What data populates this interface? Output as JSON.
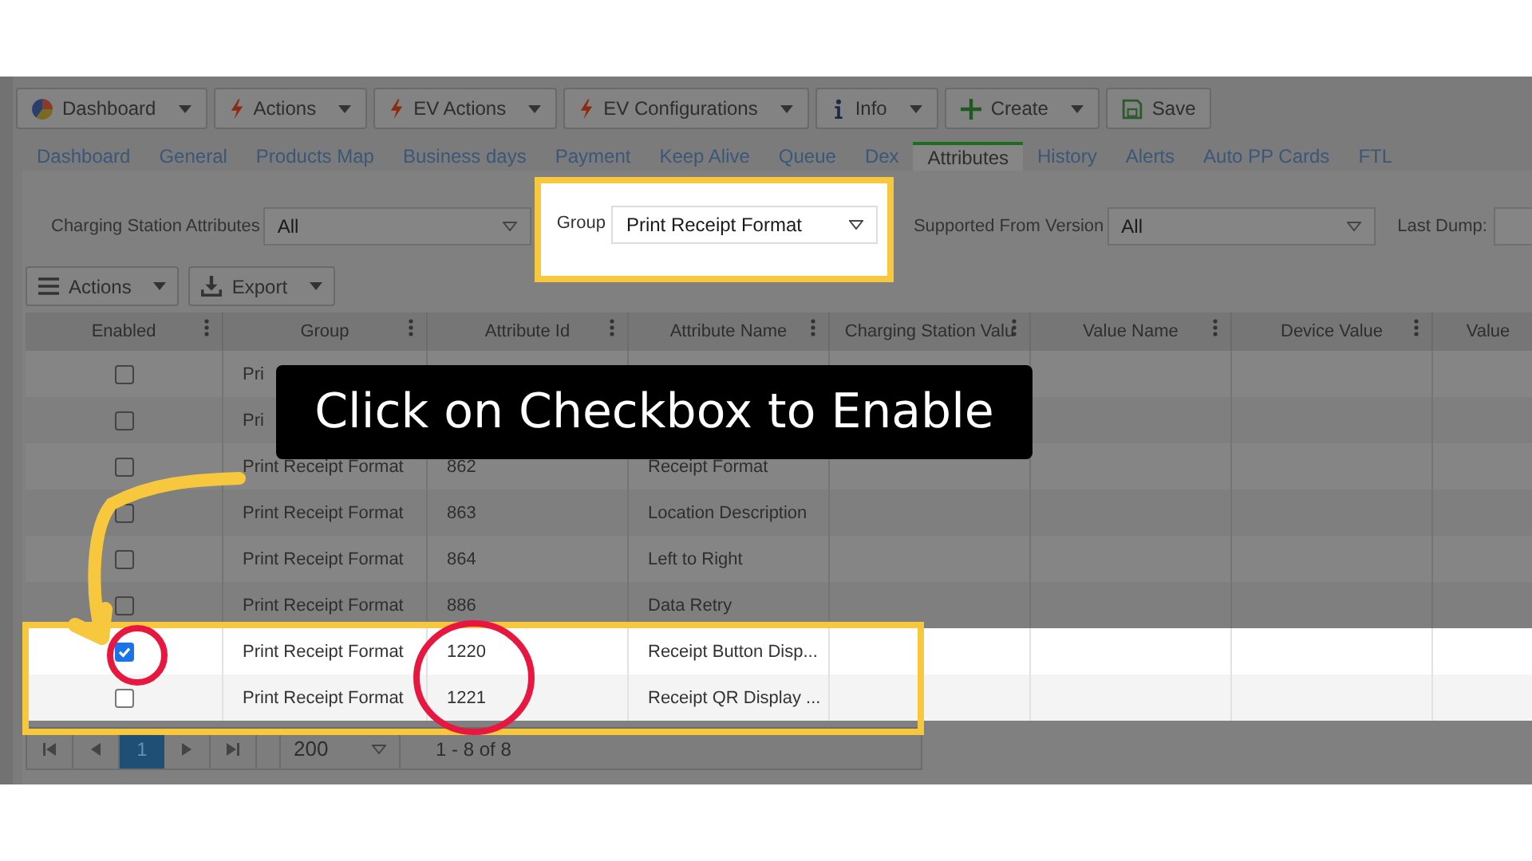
{
  "toolbar": [
    {
      "label": "Dashboard",
      "kind": "dropdown"
    },
    {
      "label": "Actions",
      "kind": "dropdown"
    },
    {
      "label": "EV Actions",
      "kind": "dropdown"
    },
    {
      "label": "EV Configurations",
      "kind": "dropdown"
    },
    {
      "label": "Info",
      "kind": "dropdown"
    },
    {
      "label": "Create",
      "kind": "dropdown"
    },
    {
      "label": "Save",
      "kind": "button"
    }
  ],
  "tabs": [
    {
      "label": "Dashboard",
      "selected": false
    },
    {
      "label": "General",
      "selected": false
    },
    {
      "label": "Products Map",
      "selected": false
    },
    {
      "label": "Business days",
      "selected": false
    },
    {
      "label": "Payment",
      "selected": false
    },
    {
      "label": "Keep Alive",
      "selected": false
    },
    {
      "label": "Queue",
      "selected": false
    },
    {
      "label": "Dex",
      "selected": false
    },
    {
      "label": "Attributes",
      "selected": true
    },
    {
      "label": "History",
      "selected": false
    },
    {
      "label": "Alerts",
      "selected": false
    },
    {
      "label": "Auto PP Cards",
      "selected": false
    },
    {
      "label": "FTL",
      "selected": false
    }
  ],
  "filters": [
    {
      "label": "Charging Station Attributes",
      "value": "All",
      "kind": "select",
      "highlighted": false
    },
    {
      "label": "Group",
      "value": "Print Receipt Format",
      "kind": "select",
      "highlighted": true
    },
    {
      "label": "Supported From Version",
      "value": "All",
      "kind": "select",
      "highlighted": false
    },
    {
      "label": "Last Dump:",
      "kind": "field",
      "highlighted": false
    }
  ],
  "grid_toolbar": [
    {
      "label": "Actions"
    },
    {
      "label": "Export"
    }
  ],
  "table": {
    "columns": [
      "Enabled",
      "Group",
      "Attribute Id",
      "Attribute Name",
      "Charging Station Valu",
      "Value Name",
      "Device Value",
      "Value"
    ],
    "rows": [
      {
        "enabled": false,
        "group": "Pri",
        "highlighted": false
      },
      {
        "enabled": false,
        "group": "Pri",
        "highlighted": false
      },
      {
        "enabled": false,
        "group": "Print Receipt Format",
        "id": "862",
        "name": "Receipt Format",
        "highlighted": false
      },
      {
        "enabled": false,
        "group": "Print Receipt Format",
        "id": "863",
        "name": "Location Description",
        "highlighted": false
      },
      {
        "enabled": false,
        "group": "Print Receipt Format",
        "id": "864",
        "name": "Left to Right",
        "highlighted": false
      },
      {
        "enabled": false,
        "group": "Print Receipt Format",
        "id": "886",
        "name": "Data Retry",
        "highlighted": false
      },
      {
        "enabled": true,
        "group": "Print Receipt Format",
        "id": "1220",
        "name": "Receipt Button Disp...",
        "highlighted": true
      },
      {
        "enabled": false,
        "group": "Print Receipt Format",
        "id": "1221",
        "name": "Receipt QR Display ...",
        "highlighted": true
      }
    ]
  },
  "pager": {
    "pages": [
      {
        "label": "1",
        "selected": true
      }
    ],
    "page_size": "200",
    "summary": "1 - 8 of 8"
  },
  "callout": {
    "text": "Click on Checkbox to Enable"
  }
}
